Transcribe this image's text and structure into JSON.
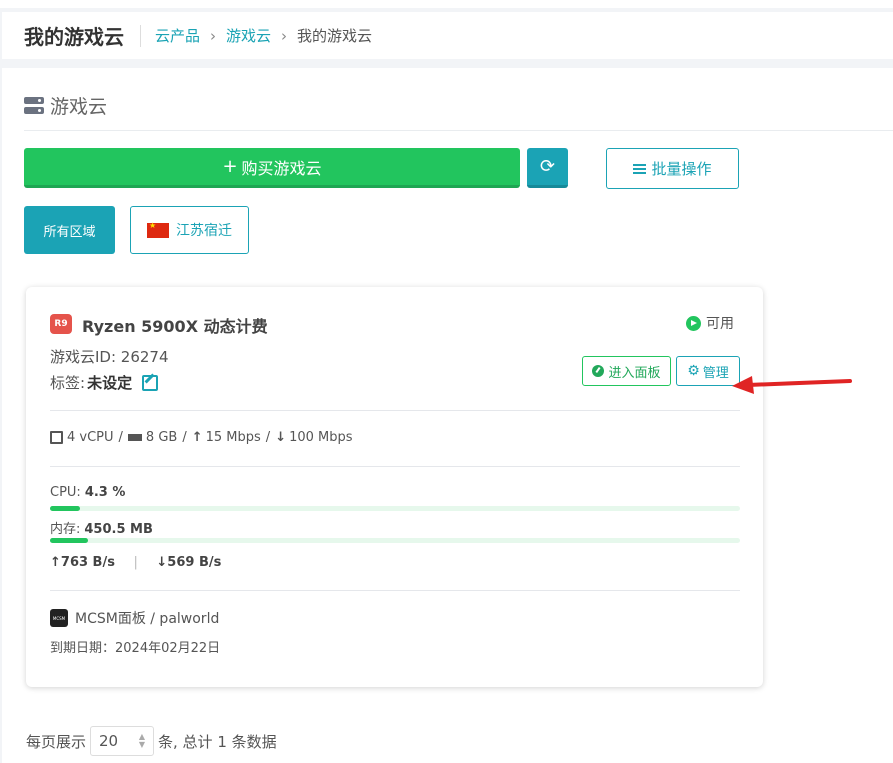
{
  "header": {
    "title": "我的游戏云",
    "breadcrumbs": [
      "云产品",
      "游戏云",
      "我的游戏云"
    ]
  },
  "section": {
    "title": "游戏云"
  },
  "toolbar": {
    "buy_label": "购买游戏云",
    "batch_label": "批量操作"
  },
  "regions": {
    "all": "所有区域",
    "jiangsu": "江苏宿迁"
  },
  "card": {
    "badge": "R9",
    "name": "Ryzen 5900X 动态计费",
    "status": "可用",
    "id_text": "游戏云ID: 26274",
    "tag_label": "标签:",
    "tag_value": "未设定",
    "panel_button": "进入面板",
    "manage_button": "管理",
    "spec": {
      "cpu": "4 vCPU",
      "ram": "8 GB",
      "up": "15 Mbps",
      "down": "100 Mbps"
    },
    "cpu_label": "CPU:",
    "cpu_value": "4.3 %",
    "cpu_fraction": 0.043,
    "mem_label": "内存:",
    "mem_value": "450.5 MB",
    "mem_fraction": 0.055,
    "net_up": "↑763 B/s",
    "net_down": "↓569 B/s",
    "panel_info": "MCSM面板 / palworld",
    "mcsm_logo_text": "MCSM",
    "expire": "到期日期：2024年02月22日"
  },
  "footer": {
    "per_page_label": "每页展示",
    "per_page_value": "20",
    "total_text": "条, 总计 1 条数据"
  },
  "colors": {
    "accent": "#1ba3b5",
    "success": "#22c55e",
    "annotation_arrow": "#e02424"
  }
}
